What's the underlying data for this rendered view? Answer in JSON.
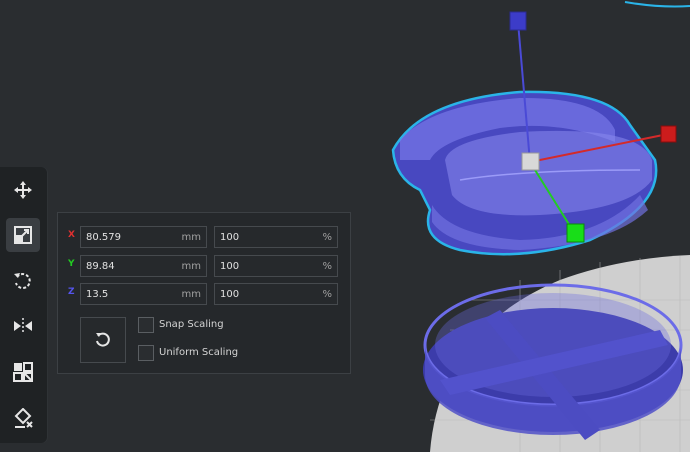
{
  "scale_panel": {
    "x": {
      "label": "X",
      "mm": "80.579",
      "mm_unit": "mm",
      "percent": "100",
      "percent_unit": "%"
    },
    "y": {
      "label": "Y",
      "mm": "89.84",
      "mm_unit": "mm",
      "percent": "100",
      "percent_unit": "%"
    },
    "z": {
      "label": "Z",
      "mm": "13.5",
      "mm_unit": "mm",
      "percent": "100",
      "percent_unit": "%"
    },
    "snap_scaling_label": "Snap Scaling",
    "uniform_scaling_label": "Uniform Scaling",
    "snap_scaling_checked": false,
    "uniform_scaling_checked": false
  },
  "toolbar": {
    "tools": [
      "move-icon",
      "scale-icon",
      "rotate-icon",
      "mirror-icon",
      "per-model-settings-icon",
      "support-blocker-icon"
    ],
    "active_tool": "scale-icon"
  },
  "colors": {
    "axis_x": "#e03030",
    "axis_y": "#22cc22",
    "axis_z": "#5555ee",
    "model_fill": "#5c5cd6",
    "model_outline": "#2ab4e8",
    "build_plate": "#c8c8c8"
  }
}
